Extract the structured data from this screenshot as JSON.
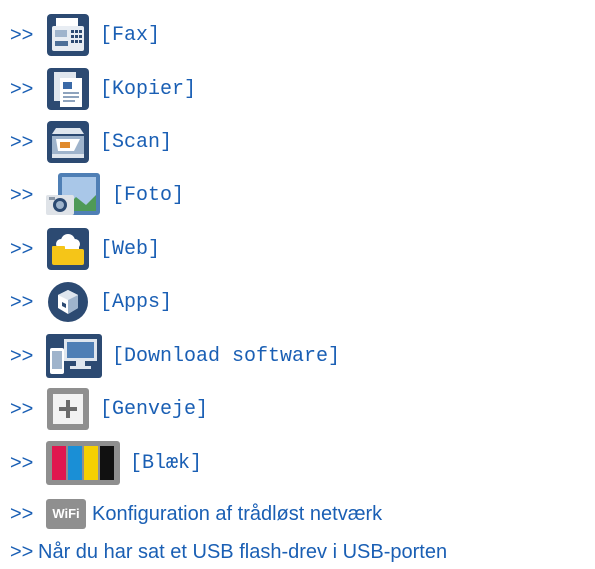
{
  "arrow": ">>",
  "items": [
    {
      "label": "[Fax]",
      "icon": "fax-icon"
    },
    {
      "label": "[Kopier]",
      "icon": "copy-icon"
    },
    {
      "label": "[Scan]",
      "icon": "scan-icon"
    },
    {
      "label": "[Foto]",
      "icon": "photo-icon"
    },
    {
      "label": "[Web]",
      "icon": "web-icon"
    },
    {
      "label": "[Apps]",
      "icon": "apps-icon"
    },
    {
      "label": "[Download software]",
      "icon": "download-software-icon"
    },
    {
      "label": "[Genveje]",
      "icon": "shortcut-icon"
    },
    {
      "label": "[Blæk]",
      "icon": "ink-icon"
    }
  ],
  "wifi": {
    "badge": "WiFi",
    "label": "Konfiguration af trådløst netværk",
    "icon": "wifi-icon"
  },
  "usb": {
    "label": "Når du har sat et USB flash-drev i USB-porten"
  },
  "colors": {
    "link": "#1a5fb4"
  }
}
